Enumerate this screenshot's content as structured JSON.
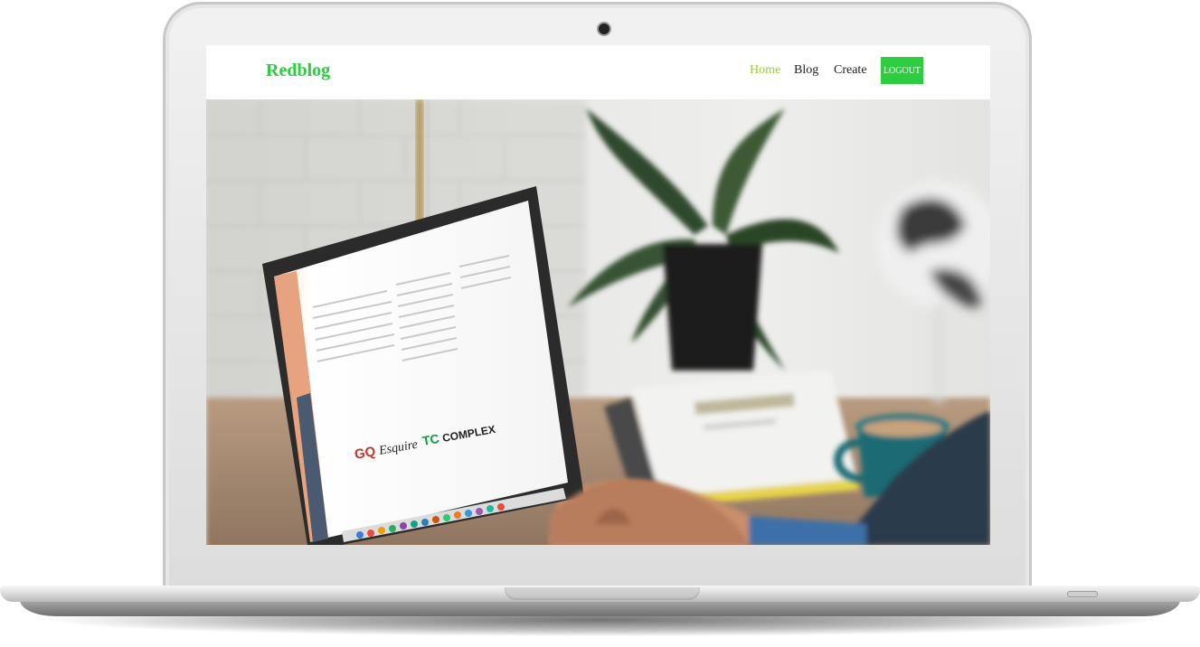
{
  "site": {
    "brand": "Redblog"
  },
  "nav": {
    "items": [
      {
        "label": "Home",
        "active": true
      },
      {
        "label": "Blog",
        "active": false
      },
      {
        "label": "Create",
        "active": false
      }
    ],
    "logout_label": "LOGOUT"
  },
  "colors": {
    "brand_green": "#2ecc40",
    "active_link": "#9acd32",
    "button_bg": "#2ecc40",
    "button_text": "#ffffff"
  },
  "hero": {
    "icons": [
      "laptop-illustration",
      "plant-illustration",
      "coffee-cup-illustration",
      "books-illustration",
      "globe-illustration"
    ]
  }
}
